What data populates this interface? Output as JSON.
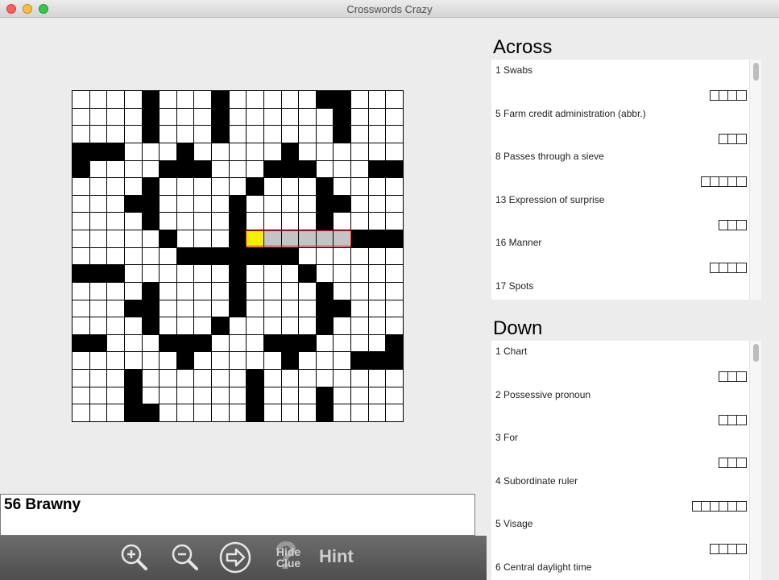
{
  "window": {
    "title": "Crosswords Crazy"
  },
  "grid": {
    "size": 19,
    "black_cells": [
      [
        0,
        4
      ],
      [
        0,
        8
      ],
      [
        0,
        14
      ],
      [
        0,
        15
      ],
      [
        1,
        4
      ],
      [
        1,
        8
      ],
      [
        1,
        15
      ],
      [
        2,
        4
      ],
      [
        2,
        8
      ],
      [
        2,
        15
      ],
      [
        3,
        0
      ],
      [
        3,
        1
      ],
      [
        3,
        2
      ],
      [
        3,
        6
      ],
      [
        3,
        12
      ],
      [
        4,
        0
      ],
      [
        4,
        5
      ],
      [
        4,
        6
      ],
      [
        4,
        7
      ],
      [
        4,
        11
      ],
      [
        4,
        12
      ],
      [
        4,
        13
      ],
      [
        4,
        17
      ],
      [
        4,
        18
      ],
      [
        5,
        4
      ],
      [
        5,
        10
      ],
      [
        5,
        14
      ],
      [
        6,
        3
      ],
      [
        6,
        4
      ],
      [
        6,
        9
      ],
      [
        6,
        14
      ],
      [
        6,
        15
      ],
      [
        7,
        4
      ],
      [
        7,
        9
      ],
      [
        7,
        14
      ],
      [
        8,
        5
      ],
      [
        8,
        9
      ],
      [
        8,
        16
      ],
      [
        8,
        17
      ],
      [
        8,
        18
      ],
      [
        9,
        6
      ],
      [
        9,
        7
      ],
      [
        9,
        8
      ],
      [
        9,
        9
      ],
      [
        9,
        10
      ],
      [
        9,
        11
      ],
      [
        9,
        12
      ],
      [
        10,
        0
      ],
      [
        10,
        1
      ],
      [
        10,
        2
      ],
      [
        10,
        9
      ],
      [
        10,
        13
      ],
      [
        11,
        4
      ],
      [
        11,
        9
      ],
      [
        11,
        14
      ],
      [
        12,
        3
      ],
      [
        12,
        4
      ],
      [
        12,
        9
      ],
      [
        12,
        14
      ],
      [
        12,
        15
      ],
      [
        13,
        4
      ],
      [
        13,
        8
      ],
      [
        13,
        14
      ],
      [
        14,
        0
      ],
      [
        14,
        1
      ],
      [
        14,
        5
      ],
      [
        14,
        6
      ],
      [
        14,
        7
      ],
      [
        14,
        11
      ],
      [
        14,
        12
      ],
      [
        14,
        13
      ],
      [
        14,
        18
      ],
      [
        15,
        6
      ],
      [
        15,
        12
      ],
      [
        15,
        16
      ],
      [
        15,
        17
      ],
      [
        15,
        18
      ],
      [
        16,
        3
      ],
      [
        16,
        10
      ],
      [
        17,
        3
      ],
      [
        17,
        10
      ],
      [
        17,
        14
      ],
      [
        18,
        3
      ],
      [
        18,
        4
      ],
      [
        18,
        10
      ],
      [
        18,
        14
      ]
    ],
    "highlighted_word": [
      [
        8,
        10
      ],
      [
        8,
        11
      ],
      [
        8,
        12
      ],
      [
        8,
        13
      ],
      [
        8,
        14
      ],
      [
        8,
        15
      ]
    ],
    "cursor_cell": [
      8,
      10
    ]
  },
  "current_clue": {
    "text": "56 Brawny"
  },
  "toolbar": {
    "zoom_in_icon": "magnifier-plus-icon",
    "zoom_out_icon": "magnifier-minus-icon",
    "next_icon": "arrow-right-circle-icon",
    "hide_clue_line1": "Hide",
    "hide_clue_line2": "Clue",
    "hide_clue_glyph": "?",
    "hint_label": "Hint"
  },
  "across": {
    "heading": "Across",
    "clues": [
      {
        "text": "1 Swabs",
        "length": 4
      },
      {
        "text": "5 Farm credit administration (abbr.)",
        "length": 3
      },
      {
        "text": "8 Passes through a sieve",
        "length": 5
      },
      {
        "text": "13 Expression of surprise",
        "length": 3
      },
      {
        "text": "16 Manner",
        "length": 4
      },
      {
        "text": "17 Spots",
        "length": 0
      }
    ]
  },
  "down": {
    "heading": "Down",
    "clues": [
      {
        "text": "1 Chart",
        "length": 3
      },
      {
        "text": "2 Possessive pronoun",
        "length": 3
      },
      {
        "text": "3 For",
        "length": 3
      },
      {
        "text": "4 Subordinate ruler",
        "length": 6
      },
      {
        "text": "5 Visage",
        "length": 4
      },
      {
        "text": "6 Central daylight time",
        "length": 0
      }
    ]
  },
  "colors": {
    "cursor": "#f4ee00",
    "highlight": "#c4c4c4",
    "word_outline": "#dd2222",
    "toolbar": "#5a5a5a"
  }
}
